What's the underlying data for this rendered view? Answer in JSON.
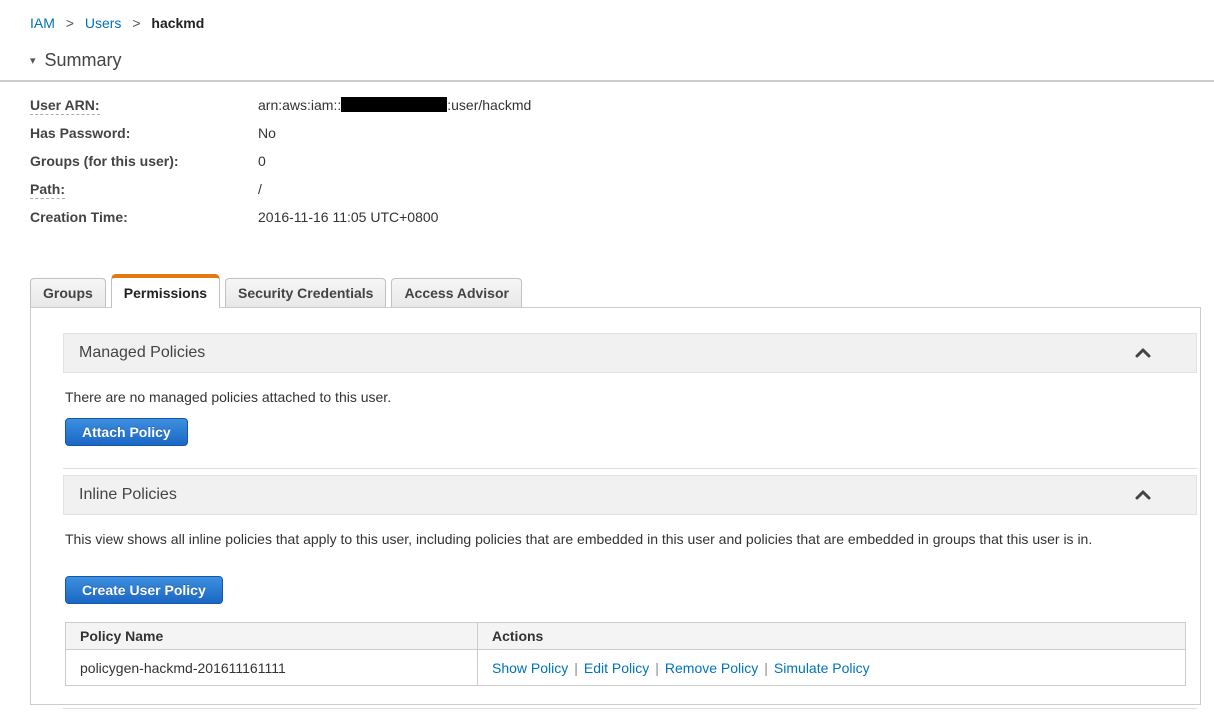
{
  "breadcrumb": {
    "separator": ">",
    "items": [
      {
        "label": "IAM"
      },
      {
        "label": "Users"
      }
    ],
    "current": "hackmd"
  },
  "summary": {
    "title": "Summary",
    "collapse_glyph": "▾",
    "fields": [
      {
        "label": "User ARN:",
        "value_prefix": "arn:aws:iam::",
        "redacted_account_id": true,
        "value_suffix": ":user/hackmd"
      },
      {
        "label": "Has Password:",
        "value": "No"
      },
      {
        "label": "Groups (for this user):",
        "value": "0"
      },
      {
        "label": "Path:",
        "value": "/"
      },
      {
        "label": "Creation Time:",
        "value": "2016-11-16 11:05 UTC+0800"
      }
    ]
  },
  "tabs": [
    {
      "label": "Groups",
      "active": false
    },
    {
      "label": "Permissions",
      "active": true
    },
    {
      "label": "Security Credentials",
      "active": false
    },
    {
      "label": "Access Advisor",
      "active": false
    }
  ],
  "managed_policies": {
    "title": "Managed Policies",
    "empty_text": "There are no managed policies attached to this user.",
    "button_label": "Attach Policy",
    "collapse_icon": "chevron-up-icon"
  },
  "inline_policies": {
    "title": "Inline Policies",
    "description": "This view shows all inline policies that apply to this user, including policies that are embedded in this user and policies that are embedded in groups that this user is in.",
    "button_label": "Create User Policy",
    "collapse_icon": "chevron-up-icon",
    "table": {
      "headers": [
        "Policy Name",
        "Actions"
      ],
      "action_separator": "|",
      "rows": [
        {
          "policy_name": "policygen-hackmd-201611161111",
          "actions": [
            "Show Policy",
            "Edit Policy",
            "Remove Policy",
            "Simulate Policy"
          ]
        }
      ]
    }
  },
  "colors": {
    "accent_orange": "#e47911",
    "link_blue": "#0073bb",
    "button_blue_top": "#3d8fe0",
    "button_blue_bottom": "#1b67c5",
    "section_bar_bg": "#f1f1f1",
    "redaction": "#000000"
  }
}
